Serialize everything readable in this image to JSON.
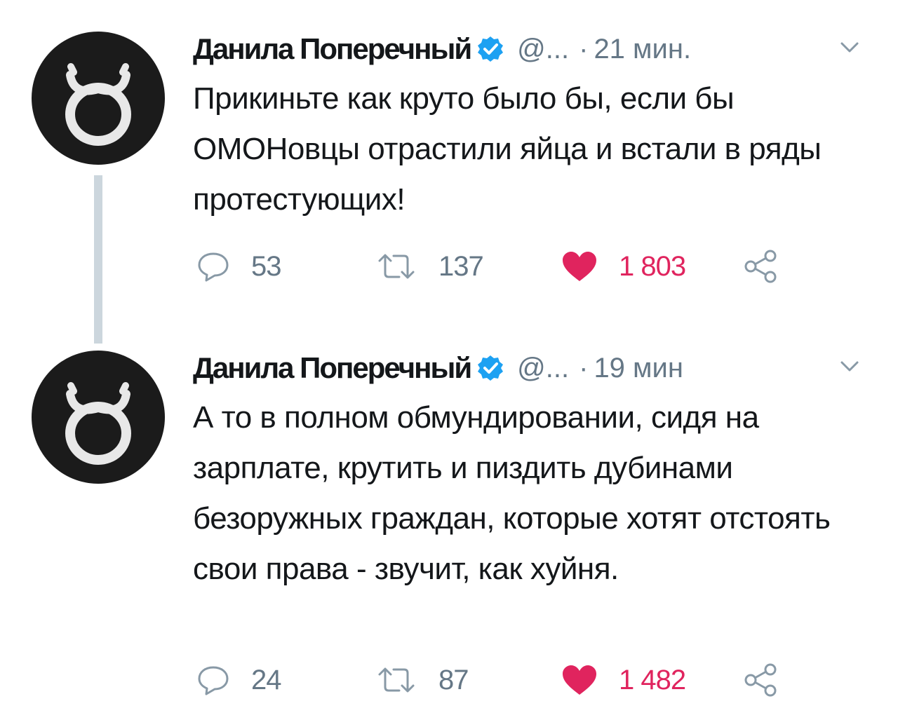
{
  "tweets": [
    {
      "author": "Данила Поперечный",
      "handle": "@...",
      "separator": "·",
      "time": "21 мин.",
      "text": "Прикиньте как круто было бы, если бы ОМОНовцы отрастили яйца и встали в ряды протестующих!",
      "replies": "53",
      "retweets": "137",
      "likes": "1 803"
    },
    {
      "author": "Данила Поперечный",
      "handle": "@...",
      "separator": "·",
      "time": "19 мин",
      "text": "А то в полном обмундировании, сидя на зарплате,  крутить и пиздить дубинами безоружных граждан, которые хотят отстоять свои права - звучит, как хуйня.",
      "replies": "24",
      "retweets": "87",
      "likes": "1 482"
    }
  ],
  "icons": {
    "verified": "verified-badge-icon",
    "caret": "chevron-down-icon",
    "reply": "reply-icon",
    "retweet": "retweet-icon",
    "like": "heart-icon",
    "share": "share-icon"
  },
  "colors": {
    "text": "#14171a",
    "muted": "#657786",
    "verified": "#1da1f2",
    "like": "#e0245e",
    "thread_line": "#ccd6dd",
    "avatar_bg": "#1b1b1b"
  }
}
